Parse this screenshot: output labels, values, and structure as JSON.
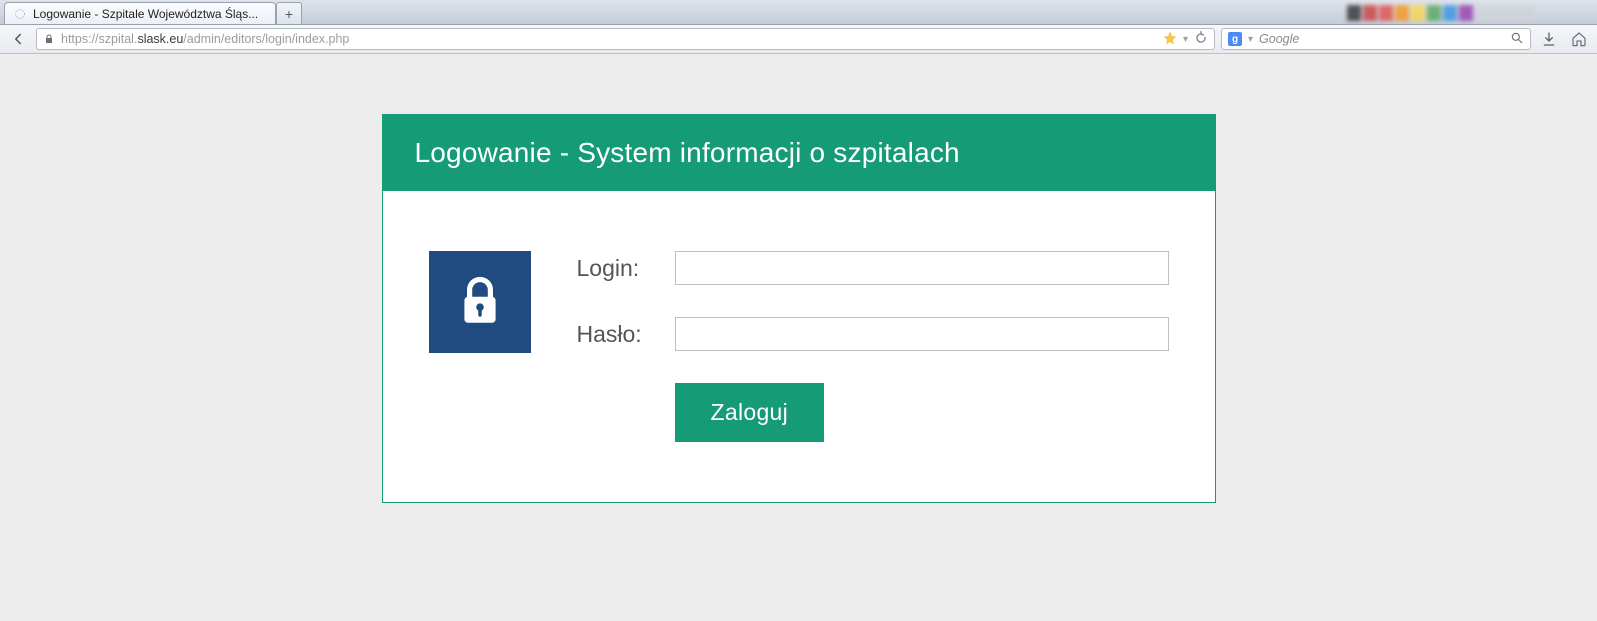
{
  "browser": {
    "tab_title": "Logowanie - Szpitale Województwa Śląs...",
    "url_prefix": "https://",
    "url_sub": "szpital.",
    "url_host": "slask.eu",
    "url_path": "/admin/editors/login/index.php",
    "search_engine_letter": "g",
    "search_placeholder": "Google"
  },
  "page": {
    "header": "Logowanie - System informacji o szpitalach",
    "login_label": "Login:",
    "password_label": "Hasło:",
    "submit_label": "Zaloguj",
    "login_value": "",
    "password_value": ""
  }
}
